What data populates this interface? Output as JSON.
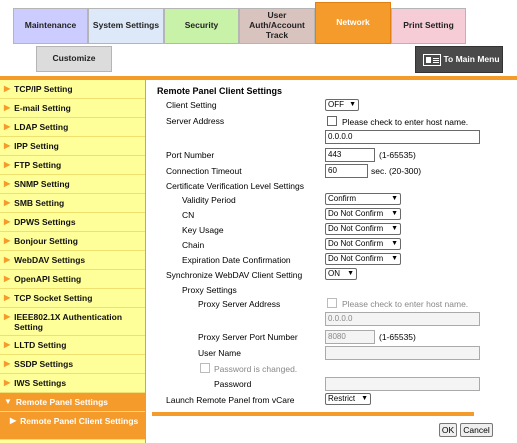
{
  "tabs": {
    "maintenance": "Maintenance",
    "system_settings": "System Settings",
    "security": "Security",
    "user_auth": "User Auth/Account Track",
    "network": "Network",
    "print_setting": "Print Setting",
    "customize": "Customize",
    "to_main_menu": "To Main Menu"
  },
  "sidebar": {
    "items": [
      {
        "label": "TCP/IP Setting"
      },
      {
        "label": "E-mail Setting"
      },
      {
        "label": "LDAP Setting"
      },
      {
        "label": "IPP Setting"
      },
      {
        "label": "FTP Setting"
      },
      {
        "label": "SNMP Setting"
      },
      {
        "label": "SMB Setting"
      },
      {
        "label": "DPWS Settings"
      },
      {
        "label": "Bonjour Setting"
      },
      {
        "label": "WebDAV Settings"
      },
      {
        "label": "OpenAPI Setting"
      },
      {
        "label": "TCP Socket Setting"
      },
      {
        "label": "IEEE802.1X Authentication Setting"
      },
      {
        "label": "LLTD Setting"
      },
      {
        "label": "SSDP Settings"
      },
      {
        "label": "IWS Settings"
      },
      {
        "label": "Remote Panel Settings"
      },
      {
        "label": "Remote Panel Client Settings"
      }
    ]
  },
  "form": {
    "title": "Remote Panel Client Settings",
    "client_setting_label": "Client Setting",
    "client_setting_value": "OFF",
    "server_address_label": "Server Address",
    "host_name_check_label": "Please check to enter host name.",
    "server_address_value": "0.0.0.0",
    "port_number_label": "Port Number",
    "port_number_value": "443",
    "port_range": "(1-65535)",
    "conn_timeout_label": "Connection Timeout",
    "conn_timeout_value": "60",
    "conn_timeout_range": "sec. (20-300)",
    "cert_level_label": "Certificate Verification Level Settings",
    "validity_label": "Validity Period",
    "validity_value": "Confirm",
    "cn_label": "CN",
    "cn_value": "Do Not Confirm",
    "key_usage_label": "Key Usage",
    "key_usage_value": "Do Not Confirm",
    "chain_label": "Chain",
    "chain_value": "Do Not Confirm",
    "exp_label": "Expiration Date Confirmation",
    "exp_value": "Do Not Confirm",
    "sync_webdav_label": "Synchronize WebDAV Client Setting",
    "sync_webdav_value": "ON",
    "proxy_label": "Proxy Settings",
    "proxy_addr_label": "Proxy Server Address",
    "proxy_host_check_label": "Please check to enter host name.",
    "proxy_addr_value": "0.0.0.0",
    "proxy_port_label": "Proxy Server Port Number",
    "proxy_port_value": "8080",
    "proxy_port_range": "(1-65535)",
    "user_name_label": "User Name",
    "pw_changed_label": "Password is changed.",
    "password_label": "Password",
    "launch_label": "Launch Remote Panel from vCare",
    "launch_value": "Restrict",
    "ok_label": "OK",
    "cancel_label": "Cancel"
  }
}
